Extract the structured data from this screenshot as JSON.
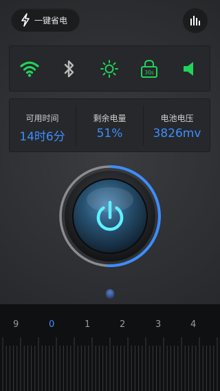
{
  "header": {
    "one_key_save_label": "一键省电"
  },
  "toggles": [
    {
      "name": "wifi",
      "icon": "wifi-icon",
      "active": true
    },
    {
      "name": "bluetooth",
      "icon": "bluetooth-icon",
      "active": false
    },
    {
      "name": "brightness",
      "icon": "brightness-icon",
      "active": true
    },
    {
      "name": "screen-timeout",
      "icon": "lock-timeout-icon",
      "label": "30s",
      "active": true
    },
    {
      "name": "sound",
      "icon": "speaker-icon",
      "active": true
    }
  ],
  "stats": {
    "available_time": {
      "title": "可用时间",
      "value": "14时6分"
    },
    "remaining": {
      "title": "剩余电量",
      "value": "51%"
    },
    "voltage": {
      "title": "电池电压",
      "value": "3826mv"
    }
  },
  "battery_level": 0.51,
  "colors": {
    "accent_green": "#22d35a",
    "accent_blue": "#3d8eff"
  },
  "ruler": {
    "numbers": [
      "9",
      "0",
      "1",
      "2",
      "3",
      "4"
    ],
    "active_index": 1
  }
}
